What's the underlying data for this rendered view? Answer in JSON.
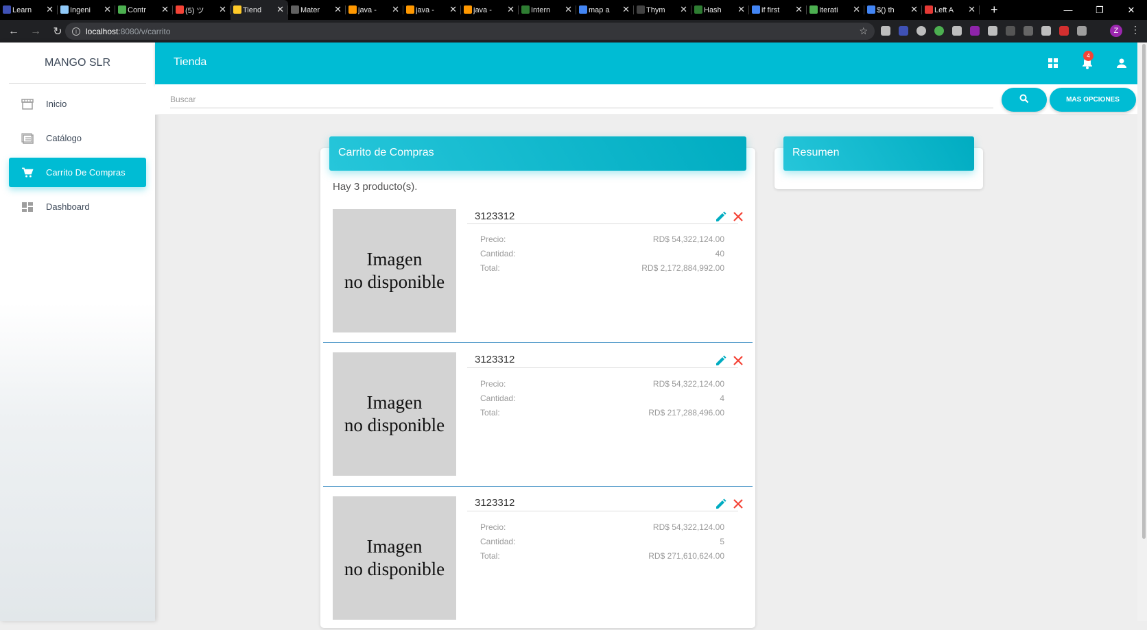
{
  "browser": {
    "tabs": [
      {
        "label": "Learn",
        "color": "#3f51b5"
      },
      {
        "label": "Ingeni",
        "color": "#90caf9"
      },
      {
        "label": "Contr",
        "color": "#4caf50"
      },
      {
        "label": "(5) ツ",
        "color": "#f44336"
      },
      {
        "label": "Tiend",
        "color": "#ffca28"
      },
      {
        "label": "Mater",
        "color": "#616161"
      },
      {
        "label": "java -",
        "color": "#ff9800"
      },
      {
        "label": "java -",
        "color": "#ff9800"
      },
      {
        "label": "java -",
        "color": "#ff9800"
      },
      {
        "label": "Intern",
        "color": "#2e7d32"
      },
      {
        "label": "map a",
        "color": "#4285f4"
      },
      {
        "label": "Thym",
        "color": "#424242"
      },
      {
        "label": "Hash",
        "color": "#2e7d32"
      },
      {
        "label": "if first",
        "color": "#4285f4"
      },
      {
        "label": "Iterati",
        "color": "#4caf50"
      },
      {
        "label": "$() th",
        "color": "#4285f4"
      },
      {
        "label": "Left A",
        "color": "#e53935"
      }
    ],
    "active_tab_index": 4,
    "url_host": "localhost",
    "url_path": ":8080/v/carrito",
    "profile_initial": "Z"
  },
  "sidebar": {
    "brand": "MANGO SLR",
    "items": [
      {
        "label": "Inicio",
        "icon": "store-icon",
        "active": false
      },
      {
        "label": "Catálogo",
        "icon": "list-icon",
        "active": false
      },
      {
        "label": "Carrito De Compras",
        "icon": "cart-icon",
        "active": true
      },
      {
        "label": "Dashboard",
        "icon": "dashboard-icon",
        "active": false
      }
    ]
  },
  "topnav": {
    "title": "Tienda",
    "notification_count": "4"
  },
  "search": {
    "placeholder": "Buscar",
    "more_label": "MAS OPCIONES"
  },
  "cart": {
    "title": "Carrito de Compras",
    "count_text": "Hay 3 producto(s).",
    "image_placeholder_line1": "Imagen",
    "image_placeholder_line2": "no disponible",
    "labels": {
      "price": "Precio:",
      "qty": "Cantidad:",
      "total": "Total:"
    },
    "items": [
      {
        "code": "3123312",
        "price": "RD$ 54,322,124.00",
        "qty": "40",
        "total": "RD$ 2,172,884,992.00"
      },
      {
        "code": "3123312",
        "price": "RD$ 54,322,124.00",
        "qty": "4",
        "total": "RD$ 217,288,496.00"
      },
      {
        "code": "3123312",
        "price": "RD$ 54,322,124.00",
        "qty": "5",
        "total": "RD$ 271,610,624.00"
      }
    ]
  },
  "summary": {
    "title": "Resumen"
  },
  "colors": {
    "accent": "#00bcd4",
    "edit": "#00acc1",
    "delete": "#f44336"
  }
}
